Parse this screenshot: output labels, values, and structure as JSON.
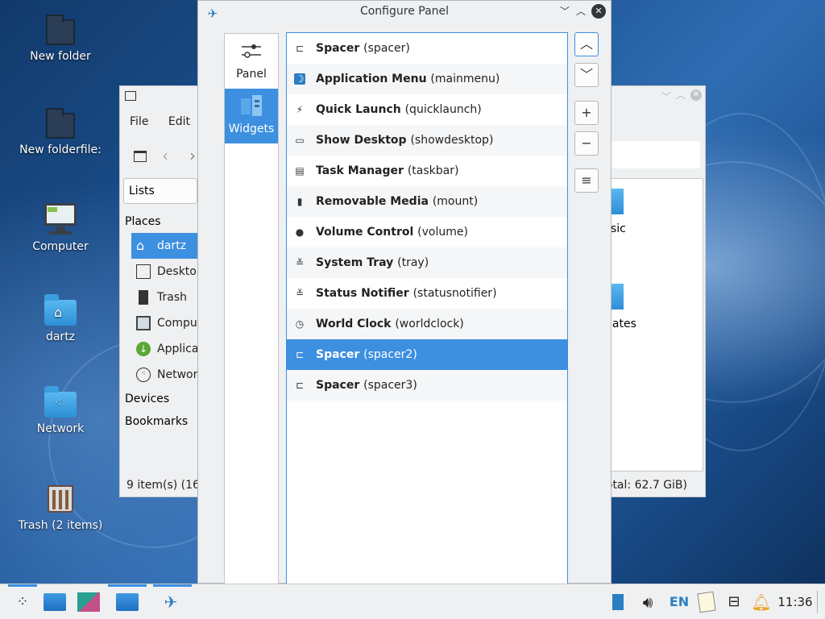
{
  "desktop": {
    "icons": [
      {
        "label": "New folder",
        "icon": "folder-icon"
      },
      {
        "label": "New folderfile:",
        "icon": "folder-icon"
      },
      {
        "label": "Computer",
        "icon": "computer-icon"
      },
      {
        "label": "dartz",
        "icon": "home-folder-icon"
      },
      {
        "label": "Network",
        "icon": "network-folder-icon"
      },
      {
        "label": "Trash (2 items)",
        "icon": "trash-icon"
      }
    ]
  },
  "file_manager": {
    "menu": [
      "File",
      "Edit"
    ],
    "view_mode": "Lists",
    "places_header": "Places",
    "places": [
      "dartz",
      "Deskto",
      "Trash",
      "Compu",
      "Applica",
      "Networ"
    ],
    "devices_header": "Devices",
    "bookmarks_header": "Bookmarks",
    "status_left": "9 item(s) (16",
    "status_right": "otal: 62.7 GiB)",
    "partial_items": [
      "sic",
      "lates"
    ]
  },
  "dialog": {
    "title": "Configure Panel",
    "pages": [
      {
        "label": "Panel",
        "icon": "sliders-icon"
      },
      {
        "label": "Widgets",
        "icon": "widgets-icon"
      }
    ],
    "widgets": [
      {
        "name": "Spacer",
        "id": "(spacer)",
        "icon": "spacer-icon"
      },
      {
        "name": "Application Menu",
        "id": "(mainmenu)",
        "icon": "app-menu-icon"
      },
      {
        "name": "Quick Launch",
        "id": "(quicklaunch)",
        "icon": "quicklaunch-icon"
      },
      {
        "name": "Show Desktop",
        "id": "(showdesktop)",
        "icon": "show-desktop-icon"
      },
      {
        "name": "Task Manager",
        "id": "(taskbar)",
        "icon": "task-manager-icon"
      },
      {
        "name": "Removable Media",
        "id": "(mount)",
        "icon": "usb-icon"
      },
      {
        "name": "Volume Control",
        "id": "(volume)",
        "icon": "volume-icon"
      },
      {
        "name": "System Tray",
        "id": "(tray)",
        "icon": "tray-icon"
      },
      {
        "name": "Status Notifier",
        "id": "(statusnotifier)",
        "icon": "tray-icon"
      },
      {
        "name": "World Clock",
        "id": "(worldclock)",
        "icon": "clock-icon"
      },
      {
        "name": "Spacer",
        "id": "(spacer2)",
        "icon": "spacer-icon"
      },
      {
        "name": "Spacer",
        "id": "(spacer3)",
        "icon": "spacer-icon"
      }
    ],
    "selected_widget_index": 10,
    "buttons": {
      "move_up": "^",
      "move_down": "v",
      "add": "+",
      "remove": "−",
      "configure": "≡"
    }
  },
  "taskbar": {
    "keyboard_layout": "EN",
    "clock": "11:36"
  },
  "colors": {
    "accent": "#3d8fe0",
    "window_bg": "#eff0f1"
  }
}
